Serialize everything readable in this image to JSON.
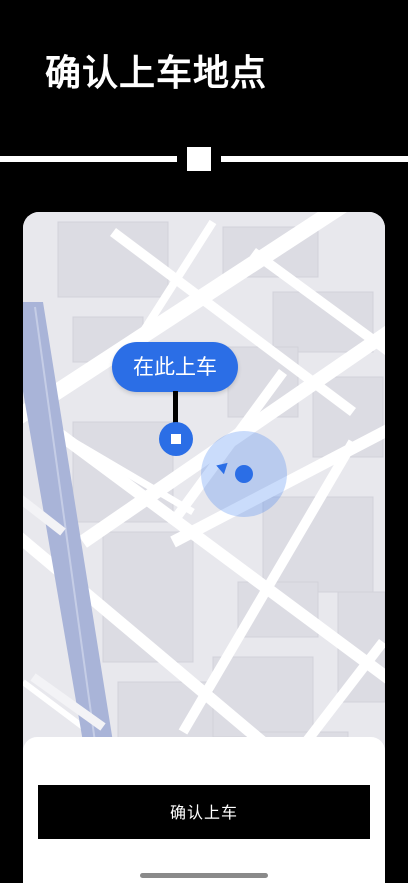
{
  "header": {
    "title": "确认上车地点"
  },
  "map": {
    "pin_label": "在此上车",
    "accent_color": "#2b6ee6",
    "icons": [
      "pickup-pin-icon",
      "current-location-icon",
      "heading-arrow-icon"
    ]
  },
  "footer": {
    "confirm_label": "确认上车"
  }
}
